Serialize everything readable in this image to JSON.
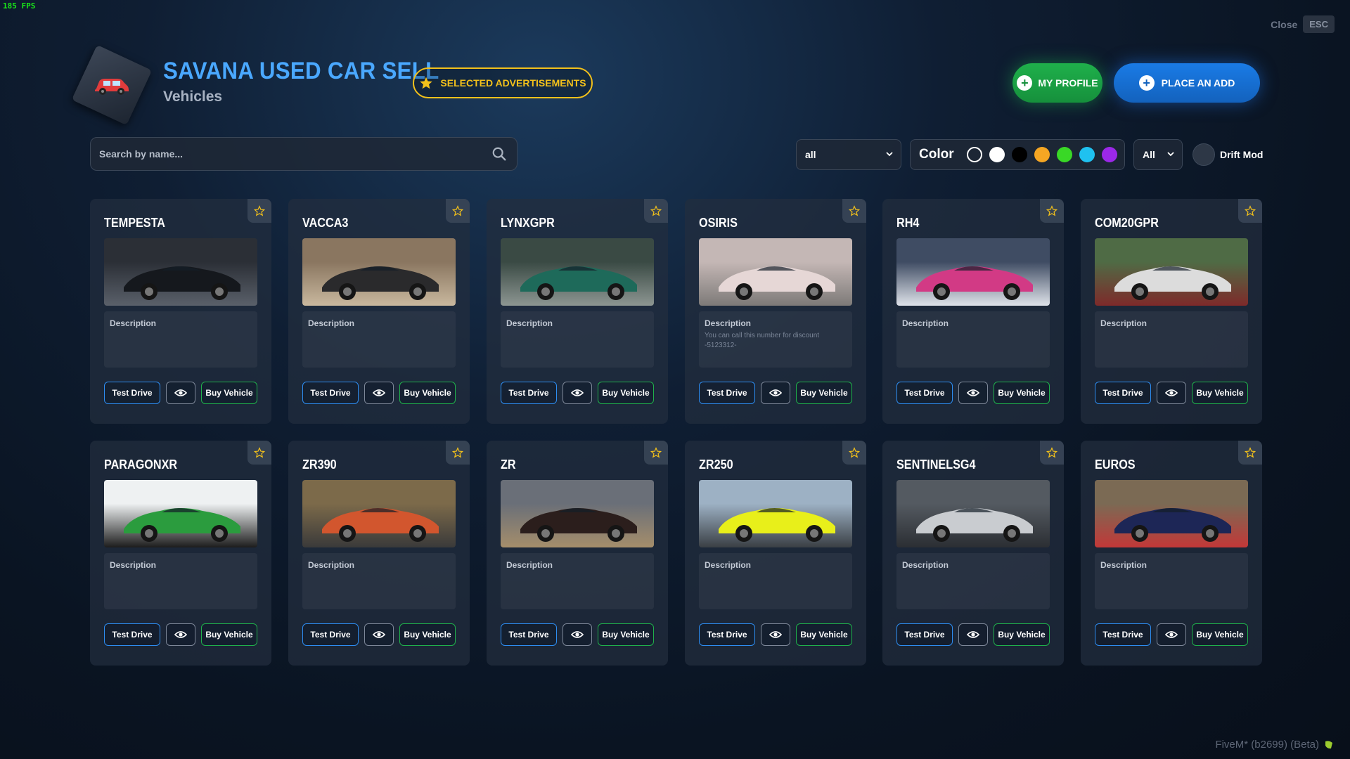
{
  "overlay": {
    "fps": "185 FPS",
    "footer": "FiveM* (b2699) (Beta)"
  },
  "window": {
    "close_label": "Close",
    "esc_key": "ESC"
  },
  "header": {
    "title": "SAVANA USED CAR SELL",
    "subtitle": "Vehicles",
    "selected_ads_label": "SELECTED ADVERTISEMENTS",
    "my_profile_label": "MY PROFILE",
    "place_add_label": "PLACE AN ADD"
  },
  "filters": {
    "search_placeholder": "Search by name...",
    "type_value": "all",
    "color_label": "Color",
    "colors": [
      "transparent",
      "#ffffff",
      "#000000",
      "#f5a623",
      "#39d826",
      "#1fc1f0",
      "#9b28e8"
    ],
    "class_value": "All",
    "drift_label": "Drift Mod"
  },
  "card_labels": {
    "description": "Description",
    "test_drive": "Test Drive",
    "buy_vehicle": "Buy Vehicle"
  },
  "vehicles": [
    {
      "name": "TEMPESTA",
      "desc": "",
      "photo": [
        "#2b2f36",
        "#15181d",
        "#5a606a"
      ]
    },
    {
      "name": "VACCA3",
      "desc": "",
      "photo": [
        "#8a7660",
        "#2a2a2c",
        "#c9b89e"
      ]
    },
    {
      "name": "LYNXGPR",
      "desc": "",
      "photo": [
        "#3a4a44",
        "#1e6a5a",
        "#8d9692"
      ]
    },
    {
      "name": "OSIRIS",
      "desc": "You can call this number for discount -5123312-",
      "photo": [
        "#c4b7b5",
        "#e6d7d6",
        "#7d7a78"
      ]
    },
    {
      "name": "RH4",
      "desc": "",
      "photo": [
        "#3f4c63",
        "#d23a85",
        "#dfe3ea"
      ]
    },
    {
      "name": "COM20GPR",
      "desc": "",
      "photo": [
        "#4f6b45",
        "#dcdcdc",
        "#7e2a2a"
      ]
    },
    {
      "name": "PARAGONXR",
      "desc": "",
      "photo": [
        "#eef1f2",
        "#2b9c3e",
        "#1c1c1c"
      ]
    },
    {
      "name": "ZR390",
      "desc": "",
      "photo": [
        "#7c6a4a",
        "#d2562e",
        "#3a3a3a"
      ]
    },
    {
      "name": "ZR",
      "desc": "",
      "photo": [
        "#6a6f78",
        "#2b1e1c",
        "#a58e6b"
      ]
    },
    {
      "name": "ZR250",
      "desc": "",
      "photo": [
        "#9db1c4",
        "#e8ef1a",
        "#3a3f44"
      ]
    },
    {
      "name": "SENTINELSG4",
      "desc": "",
      "photo": [
        "#545a61",
        "#c9ccd0",
        "#2b2e33"
      ]
    },
    {
      "name": "EUROS",
      "desc": "",
      "photo": [
        "#7b6a54",
        "#1d2656",
        "#c23838"
      ]
    }
  ]
}
